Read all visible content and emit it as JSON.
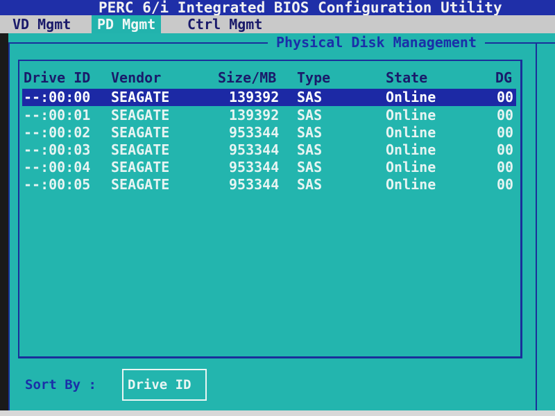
{
  "window": {
    "title": "PERC 6/i Integrated BIOS Configuration Utility"
  },
  "tabs": [
    {
      "label": "VD Mgmt",
      "active": false
    },
    {
      "label": "PD Mgmt",
      "active": true
    },
    {
      "label": "Ctrl Mgmt",
      "active": false
    }
  ],
  "section": {
    "title": "Physical Disk Management"
  },
  "table": {
    "headers": {
      "drive_id": "Drive ID",
      "vendor": "Vendor",
      "size": "Size/MB",
      "type": "Type",
      "state": "State",
      "dg": "DG"
    },
    "rows": [
      {
        "drive_id": "--:00:00",
        "vendor": "SEAGATE",
        "size": "139392",
        "type": "SAS",
        "state": "Online",
        "dg": "00",
        "selected": true
      },
      {
        "drive_id": "--:00:01",
        "vendor": "SEAGATE",
        "size": "139392",
        "type": "SAS",
        "state": "Online",
        "dg": "00",
        "selected": false
      },
      {
        "drive_id": "--:00:02",
        "vendor": "SEAGATE",
        "size": "953344",
        "type": "SAS",
        "state": "Online",
        "dg": "00",
        "selected": false
      },
      {
        "drive_id": "--:00:03",
        "vendor": "SEAGATE",
        "size": "953344",
        "type": "SAS",
        "state": "Online",
        "dg": "00",
        "selected": false
      },
      {
        "drive_id": "--:00:04",
        "vendor": "SEAGATE",
        "size": "953344",
        "type": "SAS",
        "state": "Online",
        "dg": "00",
        "selected": false
      },
      {
        "drive_id": "--:00:05",
        "vendor": "SEAGATE",
        "size": "953344",
        "type": "SAS",
        "state": "Online",
        "dg": "00",
        "selected": false
      }
    ]
  },
  "sort": {
    "label": "Sort By :",
    "value": "Drive ID"
  },
  "colors": {
    "background": "#23b5ae",
    "title_bar": "#1f2fa8",
    "selection": "#1c29a5",
    "frame": "#1a2f9a"
  }
}
